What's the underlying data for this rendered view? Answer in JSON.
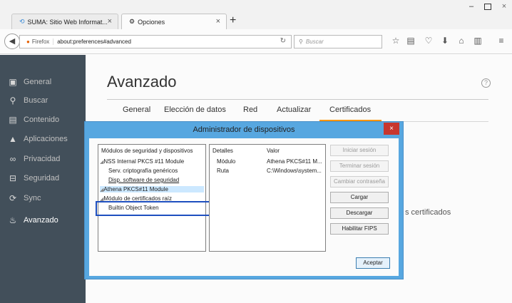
{
  "browser": {
    "tabs": [
      {
        "label": "SUMA: Sitio Web Informat...",
        "icon": "globe-icon"
      },
      {
        "label": "Opciones",
        "icon": "gear-icon"
      }
    ],
    "new_tab": "+",
    "url_label": "Firefox",
    "url": "about:preferences#advanced",
    "search_placeholder": "Buscar"
  },
  "sidebar": {
    "items": [
      {
        "label": "General",
        "icon": "general-icon"
      },
      {
        "label": "Buscar",
        "icon": "search-icon"
      },
      {
        "label": "Contenido",
        "icon": "document-icon"
      },
      {
        "label": "Aplicaciones",
        "icon": "rocket-icon"
      },
      {
        "label": "Privacidad",
        "icon": "mask-icon"
      },
      {
        "label": "Seguridad",
        "icon": "lock-icon"
      },
      {
        "label": "Sync",
        "icon": "sync-icon"
      },
      {
        "label": "Avanzado",
        "icon": "wizard-icon"
      }
    ],
    "active_index": 7
  },
  "main": {
    "title": "Avanzado",
    "tabs": [
      "General",
      "Elección de datos",
      "Red",
      "Actualizar",
      "Certificados"
    ],
    "active_tab": "Certificados",
    "background_text": "s certificados"
  },
  "dialog": {
    "title": "Administrador de dispositivos",
    "close": "×",
    "tree_header": "Módulos de seguridad y dispositivos",
    "tree": [
      {
        "label": "NSS Internal PKCS #11 Module",
        "level": 0,
        "expanded": true
      },
      {
        "label": "Serv. criptografía genéricos",
        "level": 1
      },
      {
        "label": "Disp. software de seguridad",
        "level": 1
      },
      {
        "label": "Athena PKCS#11 Module",
        "level": 0,
        "expanded": true,
        "selected": true
      },
      {
        "label": "Módulo de certificados raíz",
        "level": 0,
        "expanded": true
      },
      {
        "label": "Builtin Object Token",
        "level": 1
      }
    ],
    "details_headers": [
      "Detalles",
      "Valor"
    ],
    "details_rows": [
      [
        "Módulo",
        "Athena PKCS#11 M..."
      ],
      [
        "Ruta",
        "C:\\Windows\\system..."
      ]
    ],
    "buttons": [
      {
        "label": "Iniciar sesión",
        "enabled": false
      },
      {
        "label": "Terminar sesión",
        "enabled": false
      },
      {
        "label": "Cambiar contraseña",
        "enabled": false
      },
      {
        "label": "Cargar",
        "enabled": true
      },
      {
        "label": "Descargar",
        "enabled": true
      },
      {
        "label": "Habilitar FIPS",
        "enabled": true
      }
    ],
    "ok_label": "Aceptar"
  },
  "colors": {
    "sidebar_bg": "#424f5a",
    "dialog_frame": "#57a7e0",
    "tab_accent": "#ff9500",
    "highlight_box": "#1e4fbf"
  }
}
